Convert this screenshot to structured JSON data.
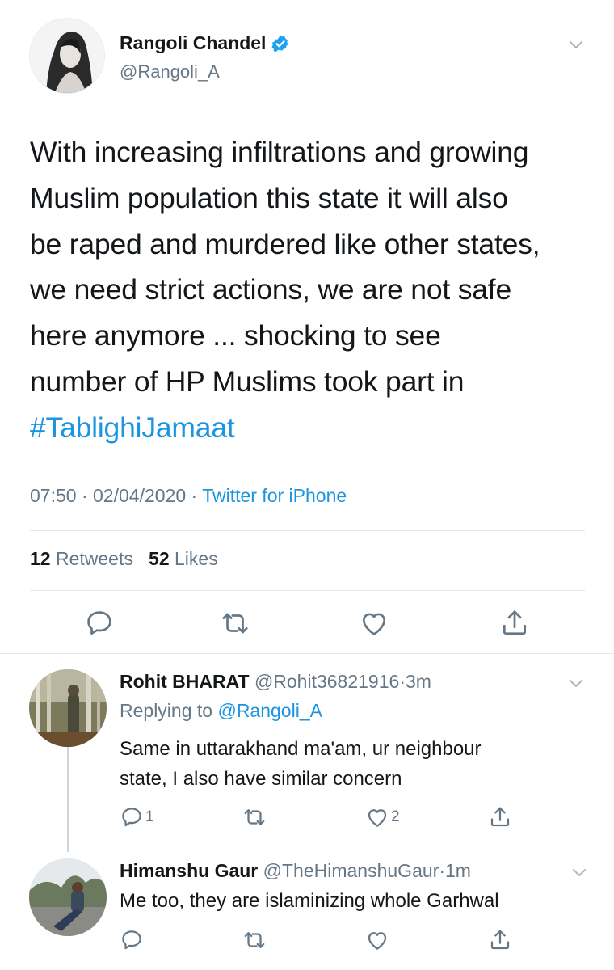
{
  "tweet": {
    "author_name": "Rangoli Chandel",
    "author_handle": "@Rangoli_A",
    "text_lines": [
      "With increasing infiltrations and growing",
      "Muslim population this state it will also",
      "be raped and murdered like other states,",
      "we need strict actions, we are not safe",
      "here anymore ... shocking to see",
      "number of HP Muslims took part in"
    ],
    "hashtag": "#TablighiJamaat",
    "time": "07:50",
    "date": "02/04/2020",
    "source": "Twitter for iPhone",
    "meta_separator": "·",
    "retweets_count": "12",
    "retweets_label": "Retweets",
    "likes_count": "52",
    "likes_label": "Likes"
  },
  "replies": [
    {
      "name": "Rohit BHARAT",
      "handle": "@Rohit36821916",
      "time": "3m",
      "replying_label": "Replying to",
      "replying_to": "@Rangoli_A",
      "text_lines": [
        "Same in uttarakhand ma'am, ur neighbour",
        "state, I also have similar concern"
      ],
      "reply_count": "1",
      "like_count": "2"
    },
    {
      "name": "Himanshu Gaur",
      "handle": "@TheHimanshuGaur",
      "time": "1m",
      "text_lines": [
        "Me too, they are islaminizing whole Garhwal"
      ]
    }
  ],
  "icons": {
    "reply": "speech-bubble-icon",
    "retweet": "retweet-arrows-icon",
    "like": "heart-icon",
    "share": "share-arrow-icon",
    "verified": "verified-badge-icon",
    "more": "chevron-down-icon"
  },
  "colors": {
    "link": "#1b95e0",
    "secondary_text": "#657786",
    "verified": "#1da1f2",
    "divider": "#e1e8ed"
  }
}
